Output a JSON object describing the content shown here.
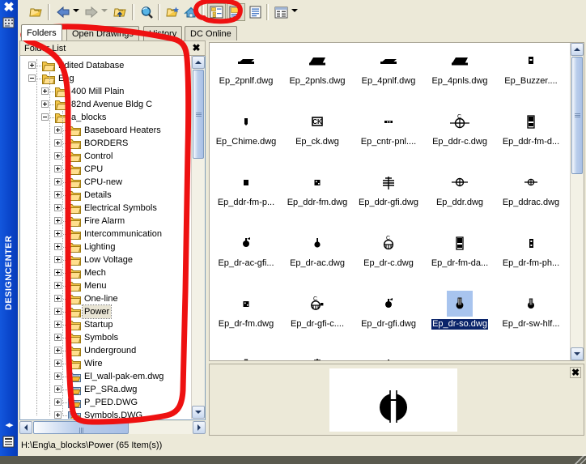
{
  "window": {
    "dock_label": "DESIGNCENTER",
    "close_icon": "close-icon",
    "status_text": "H:\\Eng\\a_blocks\\Power (65 Item(s))"
  },
  "toolbar": {
    "buttons": [
      {
        "name": "load-button",
        "icon": "open-folder-icon",
        "pressed": false
      },
      {
        "name": "back-button",
        "icon": "back-arrow-icon",
        "pressed": false
      },
      {
        "name": "forward-button",
        "icon": "forward-arrow-icon",
        "pressed": false
      },
      {
        "name": "up-button",
        "icon": "up-folder-icon",
        "pressed": false
      },
      {
        "name": "search-button",
        "icon": "search-icon",
        "pressed": false
      },
      {
        "name": "favorites-button",
        "icon": "favorites-folder-icon",
        "pressed": false
      },
      {
        "name": "home-button",
        "icon": "home-icon",
        "pressed": false
      },
      {
        "name": "tree-view-toggle",
        "icon": "tree-view-icon",
        "pressed": true
      },
      {
        "name": "preview-toggle",
        "icon": "preview-pane-icon",
        "pressed": true
      },
      {
        "name": "description-toggle",
        "icon": "description-icon",
        "pressed": false
      },
      {
        "name": "views-button",
        "icon": "views-icon",
        "pressed": false
      }
    ]
  },
  "tabs": [
    {
      "label": "Folders",
      "active": true
    },
    {
      "label": "Open Drawings",
      "active": false
    },
    {
      "label": "History",
      "active": false
    },
    {
      "label": "DC Online",
      "active": false
    }
  ],
  "folder_panel": {
    "title": "Folder List",
    "close_icon": "close-icon"
  },
  "tree": [
    {
      "label": "Edited Database",
      "depth": 1,
      "expander": "plus",
      "selected": false
    },
    {
      "label": "Eng",
      "depth": 1,
      "expander": "minus",
      "selected": false
    },
    {
      "label": "400 Mill Plain",
      "depth": 2,
      "expander": "plus",
      "selected": false
    },
    {
      "label": "82nd Avenue Bldg C",
      "depth": 2,
      "expander": "plus",
      "selected": false
    },
    {
      "label": "a_blocks",
      "depth": 2,
      "expander": "minus",
      "selected": false
    },
    {
      "label": "Baseboard Heaters",
      "depth": 3,
      "expander": "plus",
      "selected": false
    },
    {
      "label": "BORDERS",
      "depth": 3,
      "expander": "plus",
      "selected": false
    },
    {
      "label": "Control",
      "depth": 3,
      "expander": "plus",
      "selected": false
    },
    {
      "label": "CPU",
      "depth": 3,
      "expander": "plus",
      "selected": false
    },
    {
      "label": "CPU-new",
      "depth": 3,
      "expander": "plus",
      "selected": false
    },
    {
      "label": "Details",
      "depth": 3,
      "expander": "plus",
      "selected": false
    },
    {
      "label": "Electrical Symbols",
      "depth": 3,
      "expander": "plus",
      "selected": false
    },
    {
      "label": "Fire Alarm",
      "depth": 3,
      "expander": "plus",
      "selected": false
    },
    {
      "label": "Intercommunication",
      "depth": 3,
      "expander": "plus",
      "selected": false
    },
    {
      "label": "Lighting",
      "depth": 3,
      "expander": "plus",
      "selected": false
    },
    {
      "label": "Low Voltage",
      "depth": 3,
      "expander": "plus",
      "selected": false
    },
    {
      "label": "Mech",
      "depth": 3,
      "expander": "plus",
      "selected": false
    },
    {
      "label": "Menu",
      "depth": 3,
      "expander": "plus",
      "selected": false
    },
    {
      "label": "One-line",
      "depth": 3,
      "expander": "plus",
      "selected": false
    },
    {
      "label": "Power",
      "depth": 3,
      "expander": "plus",
      "selected": true
    },
    {
      "label": "Startup",
      "depth": 3,
      "expander": "plus",
      "selected": false
    },
    {
      "label": "Symbols",
      "depth": 3,
      "expander": "plus",
      "selected": false
    },
    {
      "label": "Underground",
      "depth": 3,
      "expander": "plus",
      "selected": false
    },
    {
      "label": "Wire",
      "depth": 3,
      "expander": "plus",
      "selected": false
    },
    {
      "label": "El_wall-pak-em.dwg",
      "depth": 3,
      "expander": "plus",
      "selected": false,
      "kind": "dwg"
    },
    {
      "label": "EP_SRa.dwg",
      "depth": 3,
      "expander": "plus",
      "selected": false,
      "kind": "dwg"
    },
    {
      "label": "P_PED.DWG",
      "depth": 3,
      "expander": "plus",
      "selected": false,
      "kind": "dwg"
    },
    {
      "label": "Symbols.DWG",
      "depth": 3,
      "expander": "plus",
      "selected": false,
      "kind": "dwg"
    }
  ],
  "files": [
    {
      "name": "Ep_2pnlf.dwg",
      "icon": "panel-front-symbol",
      "selected": false
    },
    {
      "name": "Ep_2pnls.dwg",
      "icon": "panel-side-symbol",
      "selected": false
    },
    {
      "name": "Ep_4pnlf.dwg",
      "icon": "panel-front-symbol",
      "selected": false
    },
    {
      "name": "Ep_4pnls.dwg",
      "icon": "panel-side-symbol",
      "selected": false
    },
    {
      "name": "Ep_Buzzer....",
      "icon": "buzzer-symbol",
      "selected": false
    },
    {
      "name": "Ep_Chime.dwg",
      "icon": "chime-symbol",
      "selected": false
    },
    {
      "name": "Ep_ck.dwg",
      "icon": "clock-symbol",
      "selected": false
    },
    {
      "name": "Ep_cntr-pnl....",
      "icon": "counter-panel-symbol",
      "selected": false
    },
    {
      "name": "Ep_ddr-c.dwg",
      "icon": "duplex-ceiling-symbol",
      "selected": false
    },
    {
      "name": "Ep_ddr-fm-d...",
      "icon": "flush-mount-symbol",
      "selected": false
    },
    {
      "name": "Ep_ddr-fm-p...",
      "icon": "box-symbol",
      "selected": false
    },
    {
      "name": "Ep_ddr-fm.dwg",
      "icon": "box-dots-symbol",
      "selected": false
    },
    {
      "name": "Ep_ddr-gfi.dwg",
      "icon": "gfi-symbol",
      "selected": false
    },
    {
      "name": "Ep_ddr.dwg",
      "icon": "duplex-symbol",
      "selected": false
    },
    {
      "name": "Ep_ddrac.dwg",
      "icon": "duplex-ac-symbol",
      "selected": false
    },
    {
      "name": "Ep_dr-ac-gfi...",
      "icon": "receptacle-gfi-symbol",
      "selected": false
    },
    {
      "name": "Ep_dr-ac.dwg",
      "icon": "receptacle-symbol",
      "selected": false
    },
    {
      "name": "Ep_dr-c.dwg",
      "icon": "ceiling-recept-symbol",
      "selected": false
    },
    {
      "name": "Ep_dr-fm-da...",
      "icon": "flush-mount-symbol",
      "selected": false
    },
    {
      "name": "Ep_dr-fm-ph...",
      "icon": "phone-box-symbol",
      "selected": false
    },
    {
      "name": "Ep_dr-fm.dwg",
      "icon": "box-dots-symbol",
      "selected": false
    },
    {
      "name": "Ep_dr-gfi-c....",
      "icon": "ceiling-gfi-symbol",
      "selected": false
    },
    {
      "name": "Ep_dr-gfi.dwg",
      "icon": "receptacle-gfi-symbol",
      "selected": false
    },
    {
      "name": "Ep_dr-so.dwg",
      "icon": "switched-outlet-symbol",
      "selected": true
    },
    {
      "name": "Ep_dr-sw-hlf...",
      "icon": "half-switched-symbol",
      "selected": false
    }
  ],
  "preview": {
    "close_icon": "close-icon",
    "symbol": "switched-outlet-symbol"
  },
  "annotation": {
    "color": "#ee1111",
    "shapes": [
      "toolbar-button-circle",
      "tree-panel-outline"
    ]
  }
}
